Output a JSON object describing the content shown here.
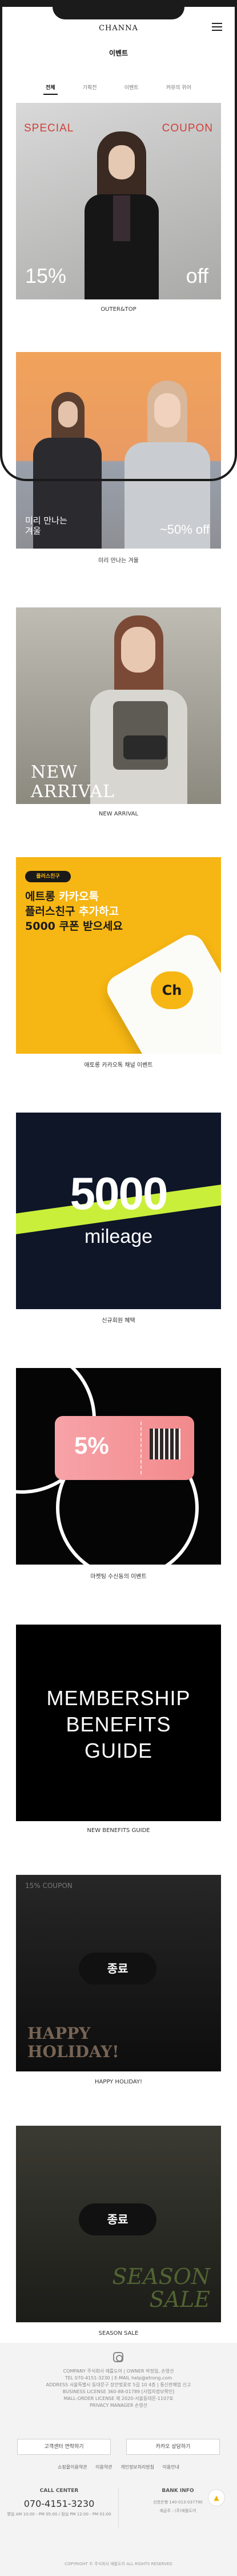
{
  "header": {
    "logo": "CHANNA",
    "page_title": "이벤트",
    "tabs": [
      {
        "label": "전체",
        "active": true
      },
      {
        "label": "기획전",
        "active": false
      },
      {
        "label": "이벤트",
        "active": false
      },
      {
        "label": "커뮤의 위어",
        "active": false
      }
    ]
  },
  "events": [
    {
      "caption": "OUTER&TOP",
      "banner": {
        "left": "SPECIAL",
        "right": "COUPON",
        "pct": "15%",
        "off": "off"
      }
    },
    {
      "caption": "미리 만나는 겨울",
      "banner": {
        "line1": "미리 만나는",
        "line2": "겨울",
        "discount": "~50% off"
      }
    },
    {
      "caption": "NEW ARRIVAL",
      "banner": {
        "line1": "NEW",
        "line2": "ARRIVAL"
      }
    },
    {
      "caption": "애토롱 카카오톡 채널 이벤트",
      "banner": {
        "pill": "플러스친구",
        "l1a": "에트롱 ",
        "l1b": "카카오톡",
        "l2a": "플러스친구 ",
        "l2b": "추가하고",
        "l3": "5000 쿠폰 받으세요",
        "badge": "Ch"
      }
    },
    {
      "caption": "신규회원 혜택",
      "banner": {
        "num": "5000",
        "word": "mileage"
      }
    },
    {
      "caption": "마켓팅 수신동의 이벤트",
      "banner": {
        "pct": "5%"
      }
    },
    {
      "caption": "NEW BENEFITS GUIDE",
      "banner": {
        "l1": "MEMBERSHIP",
        "l2": "BENEFITS",
        "l3": "GUIDE"
      }
    },
    {
      "caption": "HAPPY HOLIDAY!",
      "banner": {
        "small": "15% COUPON",
        "l1": "HAPPY",
        "l2": "HOLIDAY!",
        "status": "종료"
      }
    },
    {
      "caption": "SEASON SALE",
      "banner": {
        "l1": "SEASON",
        "l2": "SALE",
        "status": "종료"
      }
    }
  ],
  "footer": {
    "info_lines": [
      "COMPANY 주식회사 애틀도어 | OWNER 박정일, 손영선",
      "TEL 070-4151-3230 | E-MAIL help@etrong.com",
      "ADDRESS 서울특별시 동대문구 장안벚꽃로 5길 10 4층 | 통신판매업 신고",
      "BUSINESS LICENSE 360-88-01789 [사업자정보확인]",
      "MALL-ORDER LICENSE 제 2020-서울동대문-1107호",
      "PRIVACY MANAGER 손영선"
    ],
    "buttons": [
      "고객센터 연락하기",
      "카카오 상담하기"
    ],
    "links": [
      "쇼핑몰이용약관",
      "이용약관",
      "개인정보처리방침",
      "이용안내"
    ],
    "call": {
      "title": "CALL CENTER",
      "number": "070-4151-3230",
      "hours": "평일 AM 10:00 - PM 05:00 / 점심 PM 12:00 - PM 01:00"
    },
    "bank": {
      "title": "BANK INFO",
      "lines": [
        "신한은행 140-013-037790",
        "예금주 : (주)애틀도어"
      ]
    },
    "copyright": "COPYRIGHT © 주식회사 애틀도어 ALL RIGHTS RESERVED",
    "top_label": "▲"
  }
}
